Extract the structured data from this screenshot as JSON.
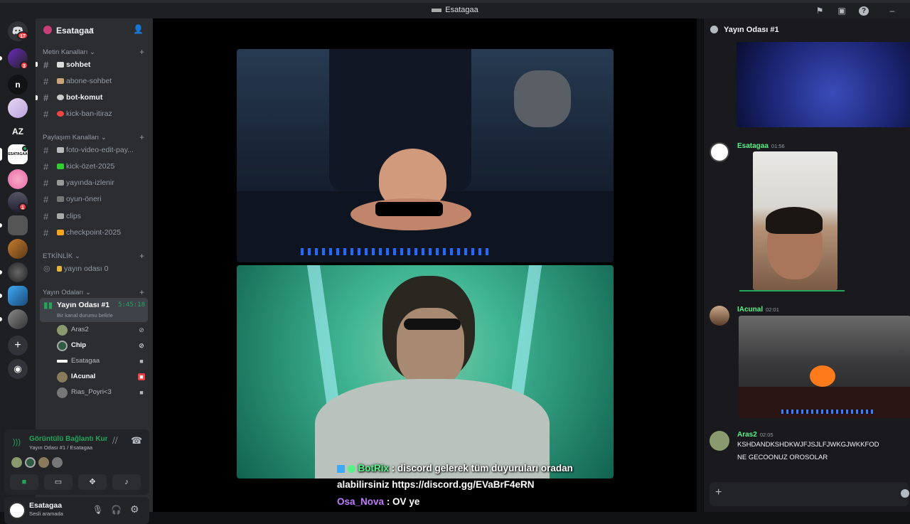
{
  "window": {
    "title": "Esatagaa"
  },
  "guilds": {
    "items": [
      {
        "label": "",
        "badge": "17"
      },
      {
        "label": "",
        "badge": "3"
      },
      {
        "label": "n",
        "badge": ""
      },
      {
        "label": "",
        "badge": ""
      },
      {
        "label": "AZ",
        "badge": ""
      },
      {
        "label": "ESATAGAA",
        "badge": ""
      },
      {
        "label": "",
        "badge": ""
      },
      {
        "label": "",
        "badge": "1"
      },
      {
        "label": "",
        "badge": ""
      },
      {
        "label": "",
        "badge": ""
      },
      {
        "label": "",
        "badge": ""
      },
      {
        "label": "",
        "badge": ""
      },
      {
        "label": "",
        "badge": ""
      }
    ]
  },
  "server": {
    "name": "Esatagaa"
  },
  "categories": {
    "text": "Metin Kanalları",
    "share": "Paylaşım Kanalları",
    "events": "ETKİNLİK",
    "stage": "Yayın Odaları"
  },
  "channels": {
    "text": [
      {
        "name": "sohbet"
      },
      {
        "name": "abone-sohbet"
      },
      {
        "name": "bot-komut"
      },
      {
        "name": "kick-ban-itiraz"
      }
    ],
    "share": [
      {
        "name": "foto-video-edit-pay..."
      },
      {
        "name": "kick-özet-2025"
      },
      {
        "name": "yayında-izlenir"
      },
      {
        "name": "oyun-öneri"
      },
      {
        "name": "clips"
      },
      {
        "name": "checkpoint-2025"
      }
    ],
    "event": {
      "name": "yayın odası 0"
    },
    "stage": {
      "name": "Yayın Odası #1",
      "timer": "5:45:18",
      "status": "Bir kanal durumu belirle"
    }
  },
  "voice_members": [
    {
      "name": "Aras2"
    },
    {
      "name": "Chip"
    },
    {
      "name": "Esatagaa"
    },
    {
      "name": "IAcunal"
    },
    {
      "name": "Rias_Poyri<3"
    }
  ],
  "voice_panel": {
    "status": "Görüntülü Bağlantı Kur",
    "location": "Yayın Odası #1 / Esatagaa"
  },
  "user_panel": {
    "name": "Esatagaa",
    "status": "Sesli aramada"
  },
  "chat": {
    "title": "Yayın Odası #1",
    "messages": [
      {
        "author": "Esatagaa",
        "time": "01:56",
        "lines": []
      },
      {
        "author": "IAcunal",
        "time": "02:01",
        "lines": []
      },
      {
        "author": "Aras2",
        "time": "02:05",
        "lines": [
          "KSHDANDKSHDKWJFJSJLFJWKGJWKKFOD",
          "NE GECOONUZ OROSOLAR"
        ]
      }
    ]
  },
  "stream_chat": {
    "line1_user": "BotRix",
    "line1_text": ": discord gelerek tüm duyuruları oradan",
    "line2_text": "alabilirsiniz https://discord.gg/EVaBrF4eRN",
    "line3_user": "Osa_Nova",
    "line3_text": ": OV ye"
  },
  "colors": {
    "accent": "#5865f2",
    "online": "#23a55a",
    "danger": "#f23f43",
    "botrix": "#57f287",
    "osa_nova": "#c07cff"
  },
  "icons": [
    "flag-icon",
    "inbox-icon",
    "help-icon",
    "minimize-icon",
    "discord-home-icon",
    "add-server-icon",
    "explore-icon",
    "invite-icon",
    "hash-icon",
    "mic-icon",
    "headphones-icon",
    "settings-icon",
    "disconnect-icon",
    "camera-icon",
    "screenshare-icon",
    "activity-icon",
    "soundboard-icon",
    "plus-icon",
    "emoji-icon"
  ]
}
